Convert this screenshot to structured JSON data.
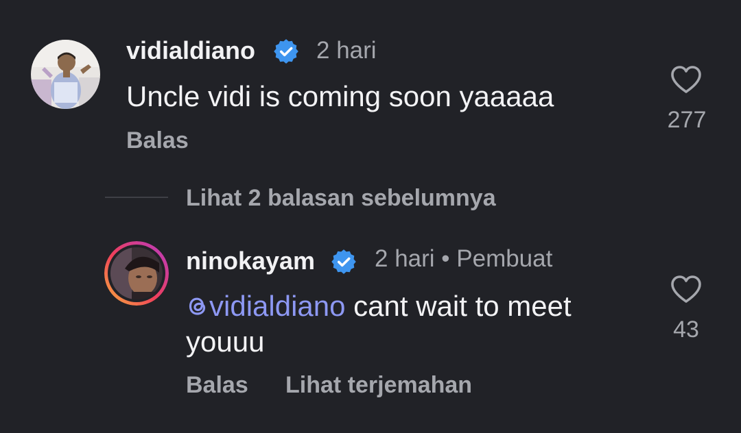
{
  "comments": [
    {
      "username": "vidialdiano",
      "verified": true,
      "time": "2 hari",
      "text": "Uncle vidi is coming soon yaaaaa",
      "reply_label": "Balas",
      "like_count": "277"
    },
    {
      "username": "ninokayam",
      "verified": true,
      "time": "2 hari • Pembuat",
      "mention": "vidialdiano",
      "text": " cant wait to meet youuu",
      "reply_label": "Balas",
      "translate_label": "Lihat terjemahan",
      "like_count": "43"
    }
  ],
  "view_replies": "Lihat 2 balasan sebelumnya",
  "colors": {
    "background": "#212227",
    "text": "#f3f3f5",
    "muted": "#a5a7ad",
    "mention": "#8d98f3",
    "verified": "#3e95ef"
  },
  "icons": [
    "verified-badge-icon",
    "heart-icon",
    "threads-icon"
  ]
}
